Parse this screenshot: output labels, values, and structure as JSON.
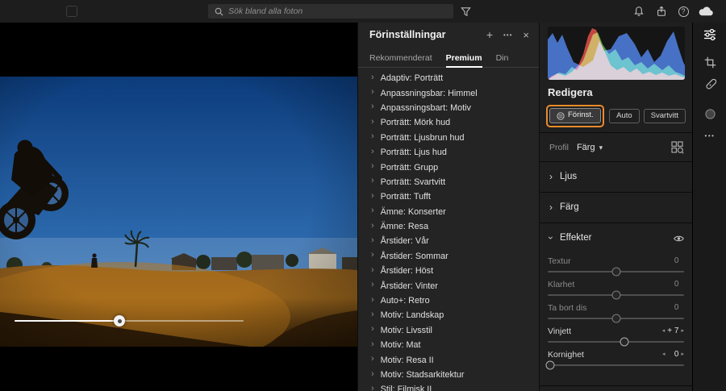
{
  "topbar": {
    "search_placeholder": "Sök bland alla foton"
  },
  "glyphs": {
    "plus": "+",
    "more": "•••",
    "close": "×",
    "chevron": "›",
    "caret_down": "▾",
    "stepper_left": "◂",
    "stepper_right": "▸",
    "help": "?"
  },
  "presets": {
    "title": "Förinställningar",
    "tabs": [
      {
        "label": "Rekommenderat",
        "active": false
      },
      {
        "label": "Premium",
        "active": true
      },
      {
        "label": "Din",
        "active": false
      }
    ],
    "items": [
      "Adaptiv: Porträtt",
      "Anpassningsbar: Himmel",
      "Anpassningsbart: Motiv",
      "Porträtt: Mörk hud",
      "Porträtt: Ljusbrun hud",
      "Porträtt: Ljus hud",
      "Porträtt: Grupp",
      "Porträtt: Svartvitt",
      "Porträtt: Tufft",
      "Ämne: Konserter",
      "Ämne: Resa",
      "Årstider: Vår",
      "Årstider: Sommar",
      "Årstider: Höst",
      "Årstider: Vinter",
      "Auto+: Retro",
      "Motiv: Landskap",
      "Motiv: Livsstil",
      "Motiv: Mat",
      "Motiv: Resa II",
      "Motiv: Stadsarkitektur",
      "Stil: Filmisk II"
    ]
  },
  "edit": {
    "title": "Redigera",
    "preset_button": "Förinst.",
    "auto_button": "Auto",
    "bw_button": "Svartvitt",
    "profile_label": "Profil",
    "profile_value": "Färg",
    "sections": {
      "ljus": "Ljus",
      "farg": "Färg",
      "effekter": "Effekter"
    },
    "sliders": [
      {
        "label": "Textur",
        "value": "0",
        "pos": 50,
        "dimmed": true
      },
      {
        "label": "Klarhet",
        "value": "0",
        "pos": 50,
        "dimmed": true
      },
      {
        "label": "Ta bort dis",
        "value": "0",
        "pos": 50,
        "dimmed": true
      },
      {
        "label": "Vinjett",
        "value": "+ 7",
        "pos": 56,
        "dimmed": false
      },
      {
        "label": "Kornighet",
        "value": "0",
        "pos": 2,
        "dimmed": false
      }
    ]
  },
  "colors": {
    "accent_orange": "#ec8a2d"
  }
}
